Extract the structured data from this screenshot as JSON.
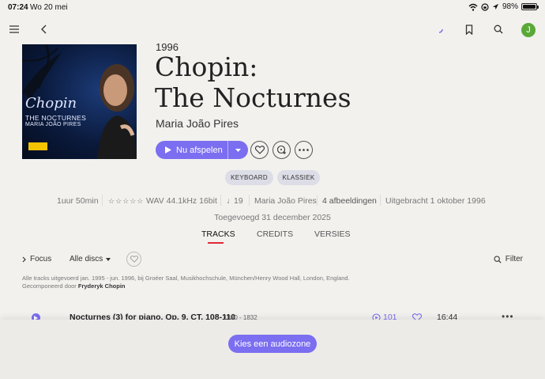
{
  "status": {
    "time": "07:24",
    "date": "Wo 20 mei",
    "battery": "98%"
  },
  "header": {
    "avatar_letter": "J"
  },
  "album": {
    "year": "1996",
    "title_line1": "Chopin:",
    "title_line2": "The Nocturnes",
    "artist": "Maria João Pires",
    "cover": {
      "title": "Chopin",
      "subtitle": "THE NOCTURNES",
      "artist": "MARIA JOÃO PIRES"
    }
  },
  "actions": {
    "play_label": "Nu afspelen"
  },
  "tags": [
    "KEYBOARD",
    "KLASSIEK"
  ],
  "meta": {
    "duration": "1uur 50min",
    "format": "WAV 44.1kHz 16bit",
    "tracks": "19",
    "artist": "Maria João Pires",
    "images": "4 afbeeldingen",
    "released": "Uitgebracht 1 oktober 1996",
    "added": "Toegevoegd 31 december 2025"
  },
  "tabs": [
    "TRACKS",
    "CREDITS",
    "VERSIES"
  ],
  "toolbar": {
    "focus": "Focus",
    "all_discs": "Alle discs",
    "filter": "Filter"
  },
  "info": {
    "recording": "Alle tracks uitgevoerd jan. 1995 - jun. 1996, bij Groéer Saal, Musikhochschule, München/Henry Wood Hall, London, England.",
    "composed_prefix": "Gecomponeerd door",
    "composer": "Fryderyk Chopin"
  },
  "track": {
    "name": "Nocturnes (3) for piano, Op. 9, CT. 108-110",
    "years": "1830 - 1832",
    "plays": "101",
    "duration": "16:44"
  },
  "bottom": {
    "zone_button": "Kies een audiozone"
  },
  "colors": {
    "accent": "#7b6ef0",
    "tab_underline": "#e0283a",
    "avatar": "#5aa838"
  }
}
